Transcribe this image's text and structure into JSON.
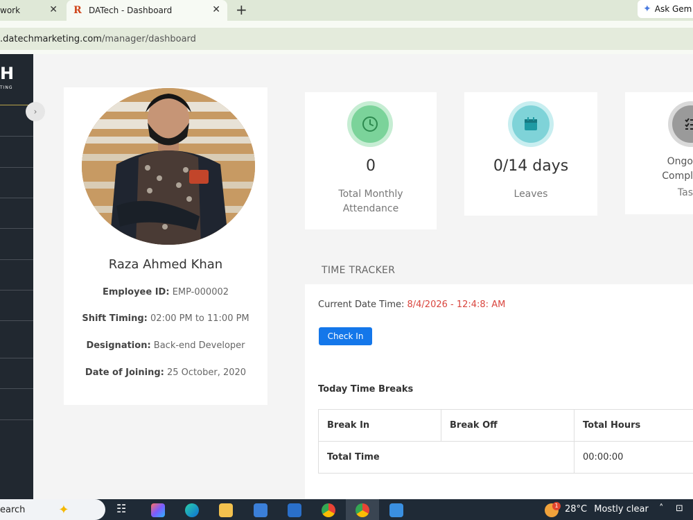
{
  "browser": {
    "tab1_label": "work",
    "tab2_label": "DATech - Dashboard",
    "new_tab": "+",
    "close_glyph": "✕",
    "gemini_label": "Ask Gem",
    "url_host": ".datechmarketing.com",
    "url_path": "/manager/dashboard"
  },
  "sidebar": {
    "logo": "H",
    "logo_sub": "TING",
    "toggle_glyph": "›"
  },
  "profile": {
    "name": "Raza Ahmed Khan",
    "employee_id_label": "Employee ID:",
    "employee_id": "EMP-000002",
    "shift_label": "Shift Timing:",
    "shift": "02:00 PM to 11:00 PM",
    "designation_label": "Designation:",
    "designation": "Back-end Developer",
    "joining_label": "Date of Joining:",
    "joining": "25 October, 2020"
  },
  "stats": {
    "attendance": {
      "value": "0",
      "label1": "Total Monthly",
      "label2": "Attendance",
      "icon": "clock-icon"
    },
    "leaves": {
      "value": "0/14 days",
      "label": "Leaves",
      "icon": "calendar-icon"
    },
    "tasks": {
      "label1": "Ongo",
      "label2": "Compl",
      "label3": "Tas",
      "icon": "task-list-icon"
    }
  },
  "time_tracker": {
    "title": "TIME TRACKER",
    "current_label": "Current Date Time:",
    "current_value": "8/4/2026 - 12:4:8: AM",
    "checkin_label": "Check In",
    "breaks_title": "Today Time Breaks",
    "headers": [
      "Break In",
      "Break Off",
      "Total Hours"
    ],
    "total_label": "Total Time",
    "total_value": "00:00:00"
  },
  "taskbar": {
    "search_label": "earch",
    "temperature": "28°C",
    "weather": "Mostly clear",
    "badge": "1"
  },
  "colors": {
    "accent_blue": "#1477ea",
    "sidebar_bg": "#212830",
    "date_red": "#d9453e",
    "attendance_green": "#7bd39a",
    "leaves_teal": "#7fd3d8"
  }
}
